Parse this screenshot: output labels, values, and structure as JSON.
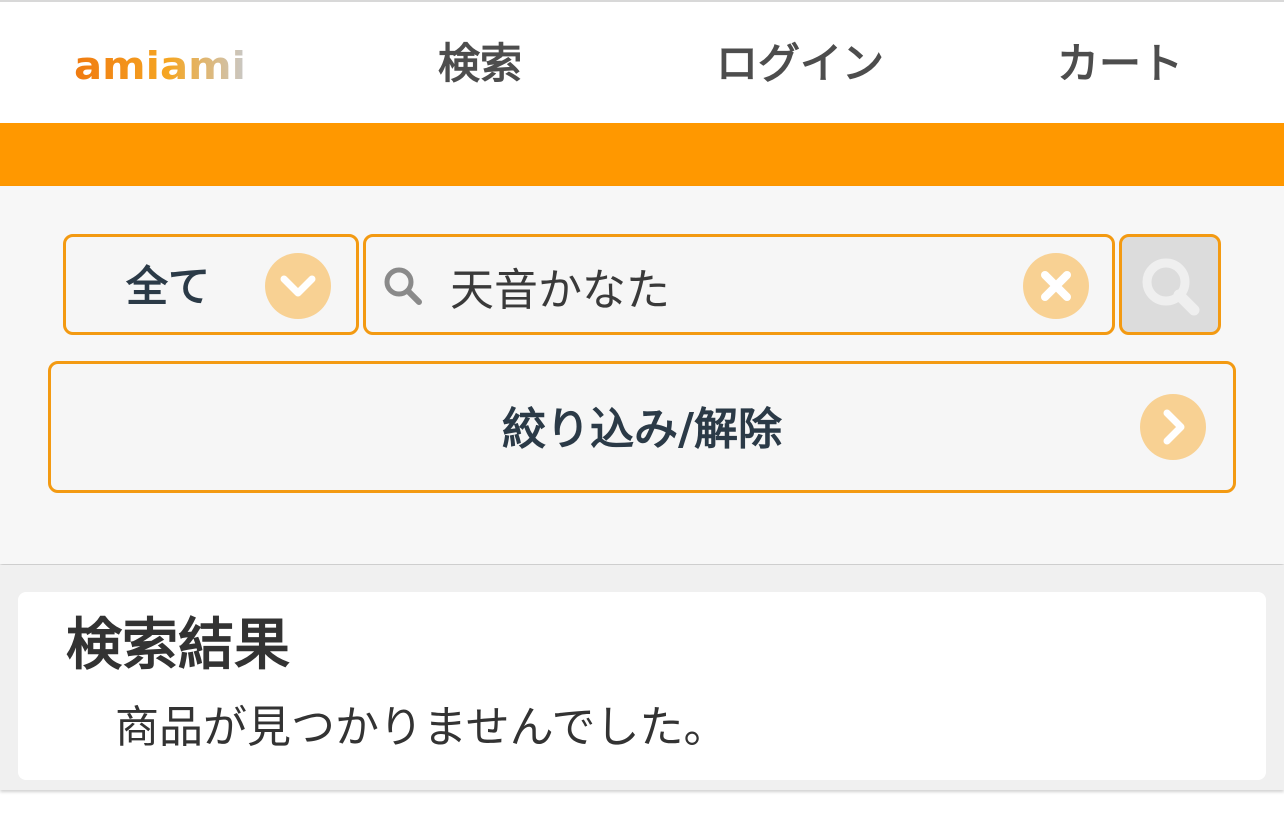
{
  "header": {
    "logo_text": "amiami",
    "nav": {
      "search": "検索",
      "login": "ログイン",
      "cart": "カート"
    }
  },
  "colors": {
    "accent": "#ff9800",
    "border": "#f39a12",
    "icon_circle": "#f8d193",
    "text_dark": "#2b3a47"
  },
  "search": {
    "category": "全て",
    "query": "天音かなた",
    "filter_label": "絞り込み/解除"
  },
  "icons": {
    "category_toggle": "chevron-down-icon",
    "input": "search-icon",
    "clear": "close-icon",
    "submit": "search-icon",
    "filter": "chevron-right-icon"
  },
  "results": {
    "title": "検索結果",
    "message": "商品が見つかりませんでした。"
  }
}
